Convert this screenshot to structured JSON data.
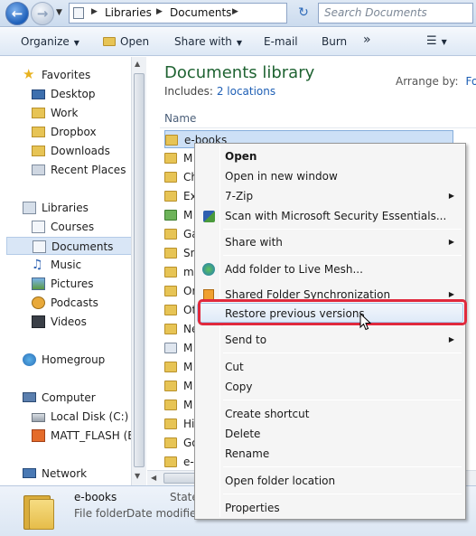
{
  "address": {
    "crumbs": [
      "Libraries",
      "Documents"
    ],
    "search_placeholder": "Search Documents"
  },
  "toolbar": {
    "organize": "Organize",
    "open": "Open",
    "share_with": "Share with",
    "email": "E-mail",
    "burn": "Burn",
    "more": "»"
  },
  "nav": {
    "favorites": "Favorites",
    "desktop": "Desktop",
    "work": "Work",
    "dropbox": "Dropbox",
    "downloads": "Downloads",
    "recent_places": "Recent Places",
    "libraries": "Libraries",
    "courses": "Courses",
    "documents": "Documents",
    "music": "Music",
    "pictures": "Pictures",
    "podcasts": "Podcasts",
    "videos": "Videos",
    "homegroup": "Homegroup",
    "computer": "Computer",
    "local_disk": "Local Disk (C:)",
    "matt_flash": "MATT_FLASH (E:",
    "network": "Network"
  },
  "content": {
    "title": "Documents library",
    "includes_label": "Includes:",
    "includes_link": "2 locations",
    "arrange_label": "Arrange by:",
    "arrange_value": "Fol",
    "column_name": "Name",
    "files": [
      "e-books",
      "M",
      "Ch",
      "Ex",
      "M",
      "Ga",
      "Sn",
      "m",
      "Or",
      "Ot",
      "Ne",
      "M",
      "M",
      "M",
      "M",
      "Hi",
      "Go",
      "e-"
    ]
  },
  "details": {
    "name": "e-books",
    "type": "File folder",
    "date_label": "Date modified",
    "state_label": "State"
  },
  "menu": {
    "open": "Open",
    "open_new_window": "Open in new window",
    "seven_zip": "7-Zip",
    "scan": "Scan with Microsoft Security Essentials...",
    "share_with": "Share with",
    "add_live_mesh": "Add folder to Live Mesh...",
    "shared_sync": "Shared Folder Synchronization",
    "restore": "Restore previous versions",
    "send_to": "Send to",
    "cut": "Cut",
    "copy": "Copy",
    "create_shortcut": "Create shortcut",
    "delete": "Delete",
    "rename": "Rename",
    "open_location": "Open folder location",
    "properties": "Properties"
  },
  "colors": {
    "title_green": "#1f6332",
    "link_blue": "#1e5fb5",
    "highlight_red": "#e0293d",
    "folder_yellow": "#e7c455"
  }
}
